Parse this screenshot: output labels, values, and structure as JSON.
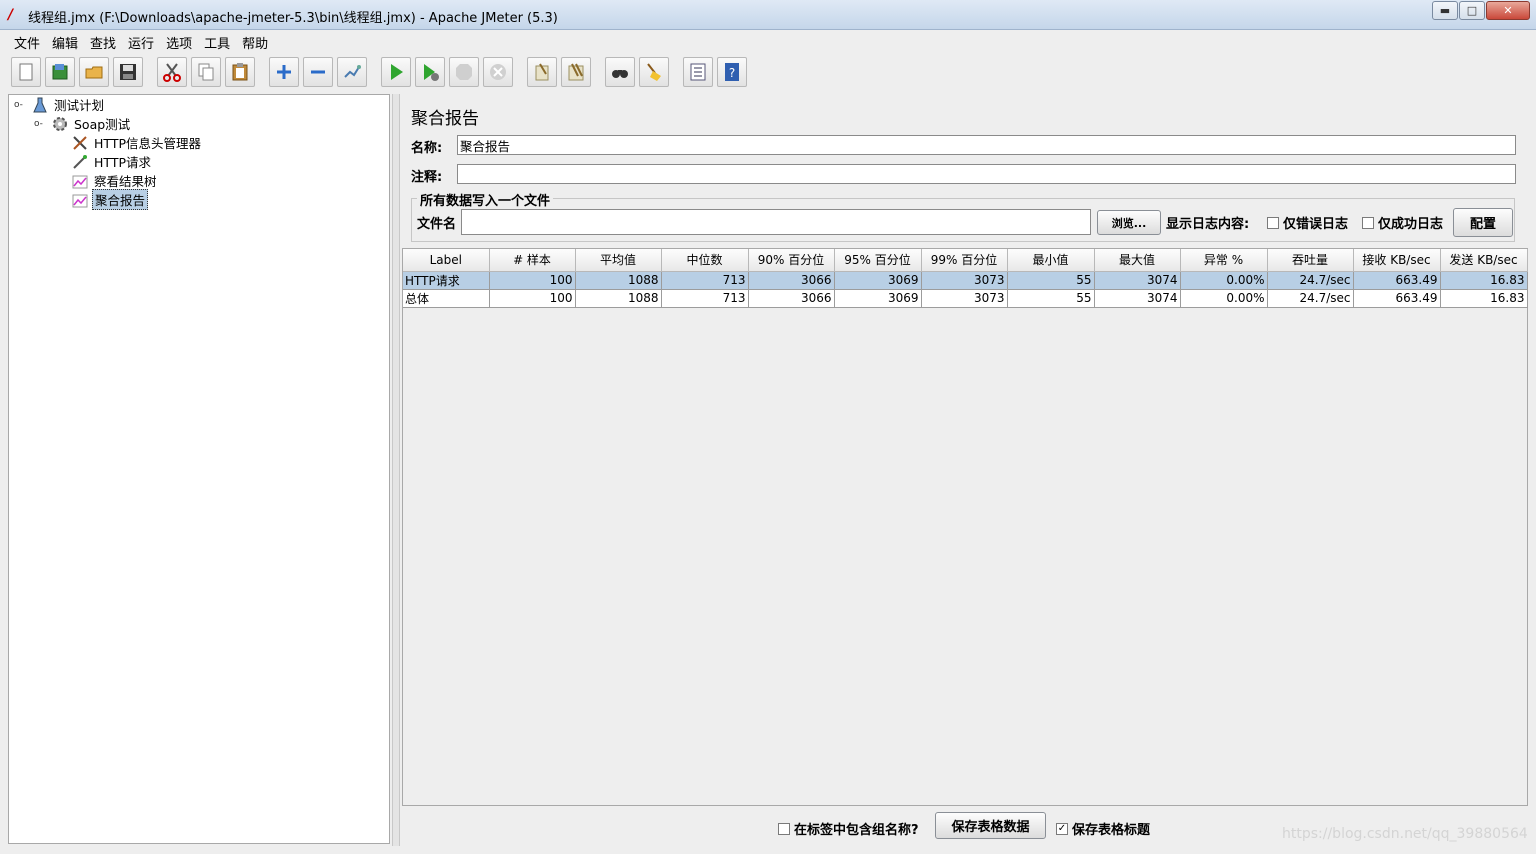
{
  "window": {
    "title": "线程组.jmx (F:\\Downloads\\apache-jmeter-5.3\\bin\\线程组.jmx) - Apache JMeter (5.3)",
    "minimize": "▬",
    "maximize": "□",
    "close": "✕"
  },
  "menu": [
    "文件",
    "编辑",
    "查找",
    "运行",
    "选项",
    "工具",
    "帮助"
  ],
  "toolbar": {
    "icons": [
      "new-icon",
      "templates-icon",
      "open-icon",
      "save-icon",
      "cut-icon",
      "copy-icon",
      "paste-icon",
      "expand-icon",
      "collapse-icon",
      "toggle-icon",
      "start-icon",
      "start-no-pause-icon",
      "stop-icon",
      "shutdown-icon",
      "clear-icon",
      "clear-all-icon",
      "search-icon",
      "reset-search-icon",
      "function-helper-icon",
      "help-icon"
    ]
  },
  "tree": {
    "nodes": [
      {
        "label": "测试计划",
        "icon": "test-plan-icon"
      },
      {
        "label": "Soap测试",
        "icon": "thread-group-icon"
      },
      {
        "label": "HTTP信息头管理器",
        "icon": "config-element-icon"
      },
      {
        "label": "HTTP请求",
        "icon": "sampler-icon"
      },
      {
        "label": "察看结果树",
        "icon": "listener-icon"
      },
      {
        "label": "聚合报告",
        "icon": "listener-icon"
      }
    ]
  },
  "panel": {
    "title": "聚合报告",
    "name_label": "名称:",
    "name_value": "聚合报告",
    "comment_label": "注释:",
    "comment_value": "",
    "file_section_title": "所有数据写入一个文件",
    "file_label": "文件名",
    "file_value": "",
    "browse_button": "浏览...",
    "log_content_label": "显示日志内容:",
    "errors_only_label": "仅错误日志",
    "success_only_label": "仅成功日志",
    "configure_button": "配置"
  },
  "table": {
    "columns": [
      "Label",
      "# 样本",
      "平均值",
      "中位数",
      "90% 百分位",
      "95% 百分位",
      "99% 百分位",
      "最小值",
      "最大值",
      "异常 %",
      "吞吐量",
      "接收 KB/sec",
      "发送 KB/sec"
    ],
    "rows": [
      [
        "HTTP请求",
        "100",
        "1088",
        "713",
        "3066",
        "3069",
        "3073",
        "55",
        "3074",
        "0.00%",
        "24.7/sec",
        "663.49",
        "16.83"
      ],
      [
        "总体",
        "100",
        "1088",
        "713",
        "3066",
        "3069",
        "3073",
        "55",
        "3074",
        "0.00%",
        "24.7/sec",
        "663.49",
        "16.83"
      ]
    ]
  },
  "bottom": {
    "include_group_label": "在标签中包含组名称?",
    "include_group_checked": false,
    "save_table_button": "保存表格数据",
    "save_header_label": "保存表格标题",
    "save_header_checked": true
  },
  "watermark": "https://blog.csdn.net/qq_39880564"
}
